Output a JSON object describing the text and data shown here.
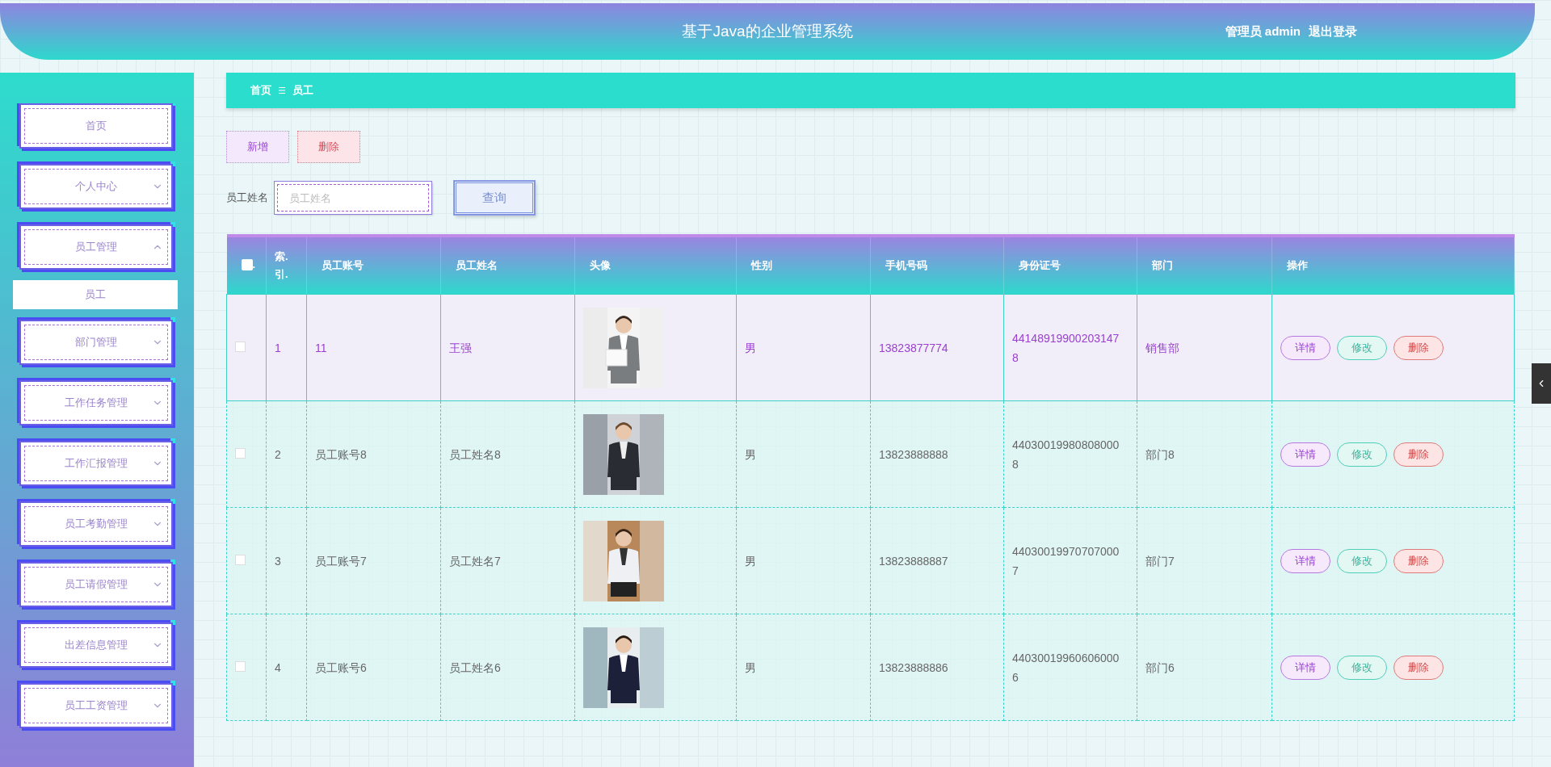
{
  "header": {
    "title": "基于Java的企业管理系统",
    "user": "管理员 admin",
    "logout": "退出登录"
  },
  "sidebar": {
    "items": [
      {
        "label": "首页",
        "kind": "link"
      },
      {
        "label": "个人中心",
        "kind": "group",
        "expanded": false
      },
      {
        "label": "员工管理",
        "kind": "group",
        "expanded": true,
        "children": [
          {
            "label": "员工",
            "selected": true
          }
        ]
      },
      {
        "label": "部门管理",
        "kind": "group",
        "expanded": false
      },
      {
        "label": "工作任务管理",
        "kind": "group",
        "expanded": false
      },
      {
        "label": "工作汇报管理",
        "kind": "group",
        "expanded": false
      },
      {
        "label": "员工考勤管理",
        "kind": "group",
        "expanded": false
      },
      {
        "label": "员工请假管理",
        "kind": "group",
        "expanded": false
      },
      {
        "label": "出差信息管理",
        "kind": "group",
        "expanded": false
      },
      {
        "label": "员工工资管理",
        "kind": "group",
        "expanded": false
      }
    ]
  },
  "breadcrumb": [
    {
      "label": "首页"
    },
    {
      "label": "员工"
    }
  ],
  "toolbar": {
    "buttons": [
      {
        "label": "新增",
        "kind": "add"
      },
      {
        "label": "删除",
        "kind": "delete"
      }
    ]
  },
  "search": {
    "label": "员工姓名",
    "placeholder": "员工姓名",
    "button": "查询"
  },
  "table": {
    "select_all": {
      "checked": false,
      "suffix": "."
    },
    "columns": [
      "索.引.",
      "员工账号",
      "员工姓名",
      "头像",
      "性别",
      "手机号码",
      "身份证号",
      "部门",
      "操作"
    ],
    "rows": [
      {
        "selected": true,
        "checked": false,
        "index": "1",
        "account": "11",
        "name": "王强",
        "avatar": {
          "kind": "picture"
        },
        "gender": "男",
        "phone": "13823877774",
        "id_number": "441489199002031478",
        "department": "销售部",
        "actions": [
          {
            "label": "详情",
            "kind": "detail"
          },
          {
            "label": "修改",
            "kind": "edit"
          },
          {
            "label": "删除",
            "kind": "delete"
          }
        ]
      },
      {
        "selected": false,
        "checked": false,
        "index": "2",
        "account": "员工账号8",
        "name": "员工姓名8",
        "avatar": {
          "kind": "picture"
        },
        "gender": "男",
        "phone": "13823888888",
        "id_number": "440300199808080008",
        "department": "部门8",
        "actions": [
          {
            "label": "详情",
            "kind": "detail"
          },
          {
            "label": "修改",
            "kind": "edit"
          },
          {
            "label": "删除",
            "kind": "delete"
          }
        ]
      },
      {
        "selected": false,
        "checked": false,
        "index": "3",
        "account": "员工账号7",
        "name": "员工姓名7",
        "avatar": {
          "kind": "picture"
        },
        "gender": "男",
        "phone": "13823888887",
        "id_number": "440300199707070007",
        "department": "部门7",
        "actions": [
          {
            "label": "详情",
            "kind": "detail"
          },
          {
            "label": "修改",
            "kind": "edit"
          },
          {
            "label": "删除",
            "kind": "delete"
          }
        ]
      },
      {
        "selected": false,
        "checked": false,
        "index": "4",
        "account": "员工账号6",
        "name": "员工姓名6",
        "avatar": {
          "kind": "picture"
        },
        "gender": "男",
        "phone": "13823888886",
        "id_number": "440300199606060006",
        "department": "部门6",
        "actions": [
          {
            "label": "详情",
            "kind": "detail"
          },
          {
            "label": "修改",
            "kind": "edit"
          },
          {
            "label": "删除",
            "kind": "delete"
          }
        ]
      }
    ]
  }
}
